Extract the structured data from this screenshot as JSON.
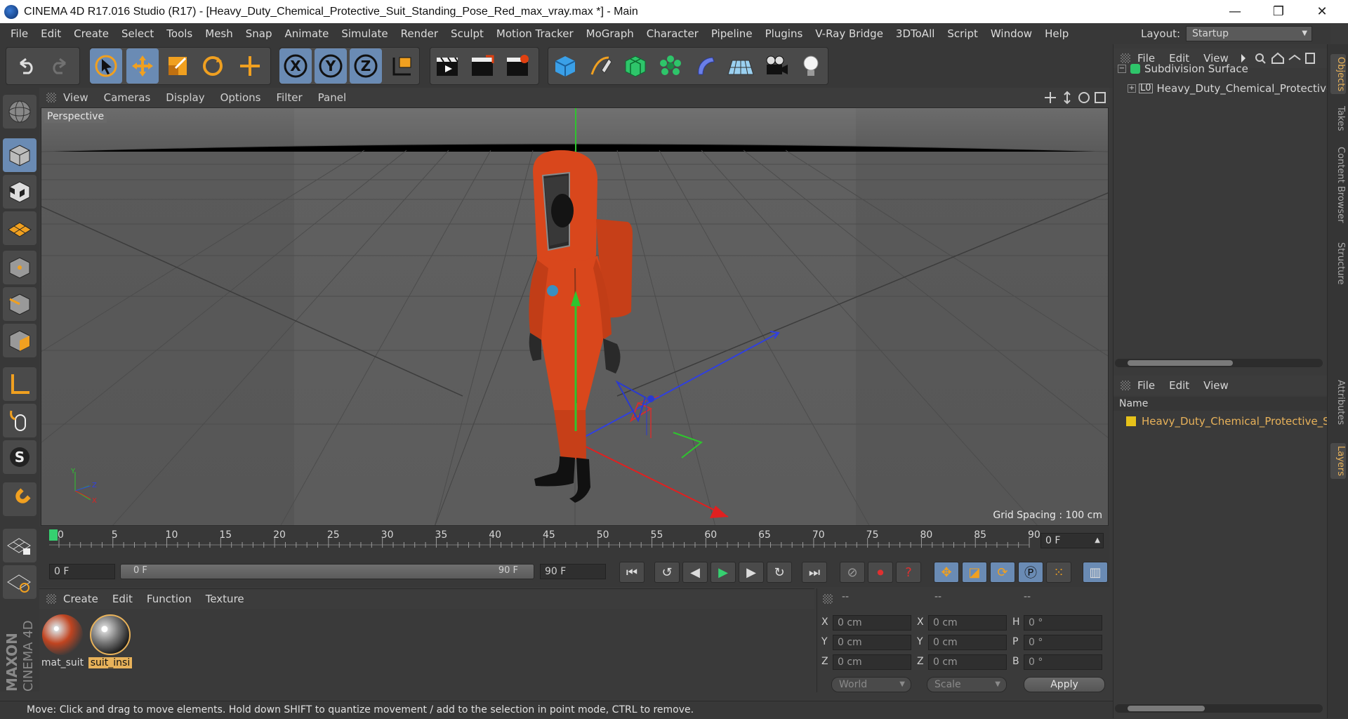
{
  "window": {
    "title": "CINEMA 4D R17.016 Studio (R17) - [Heavy_Duty_Chemical_Protective_Suit_Standing_Pose_Red_max_vray.max *] - Main",
    "minimize": "—",
    "restore": "❐",
    "close": "✕"
  },
  "menu": [
    "File",
    "Edit",
    "Create",
    "Select",
    "Tools",
    "Mesh",
    "Snap",
    "Animate",
    "Simulate",
    "Render",
    "Sculpt",
    "Motion Tracker",
    "MoGraph",
    "Character",
    "Pipeline",
    "Plugins",
    "V-Ray Bridge",
    "3DToAll",
    "Script",
    "Window",
    "Help"
  ],
  "layout": {
    "label": "Layout:",
    "value": "Startup"
  },
  "toolbar": {
    "x_label": "X",
    "y_label": "Y",
    "z_label": "Z"
  },
  "viewport_menu": [
    "View",
    "Cameras",
    "Display",
    "Options",
    "Filter",
    "Panel"
  ],
  "viewport": {
    "label": "Perspective",
    "grid_spacing": "Grid Spacing : 100 cm",
    "axis_y": "Y",
    "axis_z": "Z",
    "axis_x": "X"
  },
  "timeline": {
    "ticks": [
      "0",
      "5",
      "10",
      "15",
      "20",
      "25",
      "30",
      "35",
      "40",
      "45",
      "50",
      "55",
      "60",
      "65",
      "70",
      "75",
      "80",
      "85",
      "90"
    ],
    "current_frame": "0 F"
  },
  "playback": {
    "start_field": "0 F",
    "slider_start": "0 F",
    "slider_end": "90 F",
    "end_field": "90 F"
  },
  "materials": {
    "menu": [
      "Create",
      "Edit",
      "Function",
      "Texture"
    ],
    "items": [
      {
        "name": "mat_suit"
      },
      {
        "name": "suit_insi"
      }
    ]
  },
  "coords": {
    "headers": [
      "--",
      "--",
      "--"
    ],
    "pos": [
      {
        "axis": "X",
        "value": "0 cm"
      },
      {
        "axis": "Y",
        "value": "0 cm"
      },
      {
        "axis": "Z",
        "value": "0 cm"
      }
    ],
    "size": [
      {
        "axis": "X",
        "value": "0 cm"
      },
      {
        "axis": "Y",
        "value": "0 cm"
      },
      {
        "axis": "Z",
        "value": "0 cm"
      }
    ],
    "rot": [
      {
        "axis": "H",
        "value": "0 °"
      },
      {
        "axis": "P",
        "value": "0 °"
      },
      {
        "axis": "B",
        "value": "0 °"
      }
    ],
    "world_dropdown": "World",
    "scale_dropdown": "Scale",
    "apply": "Apply"
  },
  "object_manager": {
    "menu": [
      "File",
      "Edit",
      "View"
    ],
    "objects": [
      {
        "name": "Subdivision Surface"
      },
      {
        "name": "Heavy_Duty_Chemical_Protective_"
      }
    ]
  },
  "layer_manager": {
    "menu": [
      "File",
      "Edit",
      "View"
    ],
    "column": "Name",
    "layers": [
      {
        "name": "Heavy_Duty_Chemical_Protective_S"
      }
    ]
  },
  "side_tabs": [
    "Objects",
    "Takes",
    "Content Browser",
    "Structure",
    "Attributes",
    "Layers"
  ],
  "brand": {
    "maxon": "MAXON",
    "product": "CINEMA 4D"
  },
  "status": "Move: Click and drag to move elements. Hold down SHIFT to quantize movement / add to the selection in point mode, CTRL to remove.",
  "colors": {
    "accent": "#6a8bb4",
    "suit_red": "#d9471c",
    "layer_yellow": "#e6c21a",
    "highlight_orange": "#e8b25a"
  }
}
